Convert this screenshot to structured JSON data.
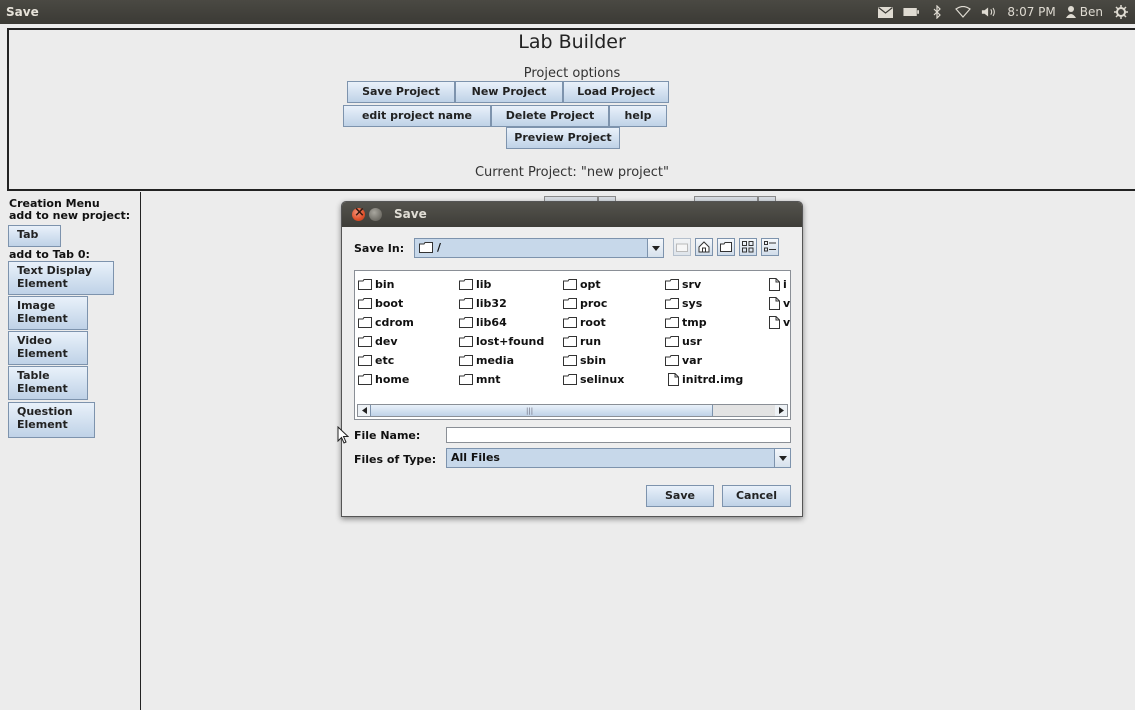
{
  "window": {
    "title": "Save"
  },
  "tray": {
    "time": "8:07 PM",
    "user": "Ben"
  },
  "header": {
    "app_title": "Lab Builder",
    "options_label": "Project options",
    "buttons": {
      "save": "Save Project",
      "new": "New Project",
      "load": "Load Project",
      "edit_name": "edit project name",
      "delete": "Delete Project",
      "help": "help",
      "preview": "Preview Project"
    },
    "current_project": "Current Project: \"new project\""
  },
  "sidebar": {
    "creation_menu": "Creation Menu",
    "add_to_new_project": "add to new project:",
    "tab_button": "Tab",
    "add_to_tab": "add to Tab 0:",
    "elements": [
      {
        "line1": "Text Display",
        "line2": "Element"
      },
      {
        "line1": "Image",
        "line2": "Element"
      },
      {
        "line1": "Video",
        "line2": "Element"
      },
      {
        "line1": "Table",
        "line2": "Element"
      },
      {
        "line1": "Question",
        "line2": "Element"
      }
    ]
  },
  "dialog": {
    "title": "Save",
    "save_in_label": "Save In:",
    "save_in_value": "/",
    "files": {
      "col1": [
        "bin",
        "boot",
        "cdrom",
        "dev",
        "etc",
        "home"
      ],
      "col2": [
        "lib",
        "lib32",
        "lib64",
        "lost+found",
        "media",
        "mnt"
      ],
      "col3": [
        "opt",
        "proc",
        "root",
        "run",
        "sbin",
        "selinux"
      ],
      "col4": [
        "srv",
        "sys",
        "tmp",
        "usr",
        "var"
      ],
      "col4_file": "initrd.img",
      "col5_files": [
        "i",
        "v",
        "v"
      ]
    },
    "file_name_label": "File Name:",
    "file_name_value": "",
    "files_of_type_label": "Files of Type:",
    "files_of_type_value": "All Files",
    "save_button": "Save",
    "cancel_button": "Cancel"
  }
}
